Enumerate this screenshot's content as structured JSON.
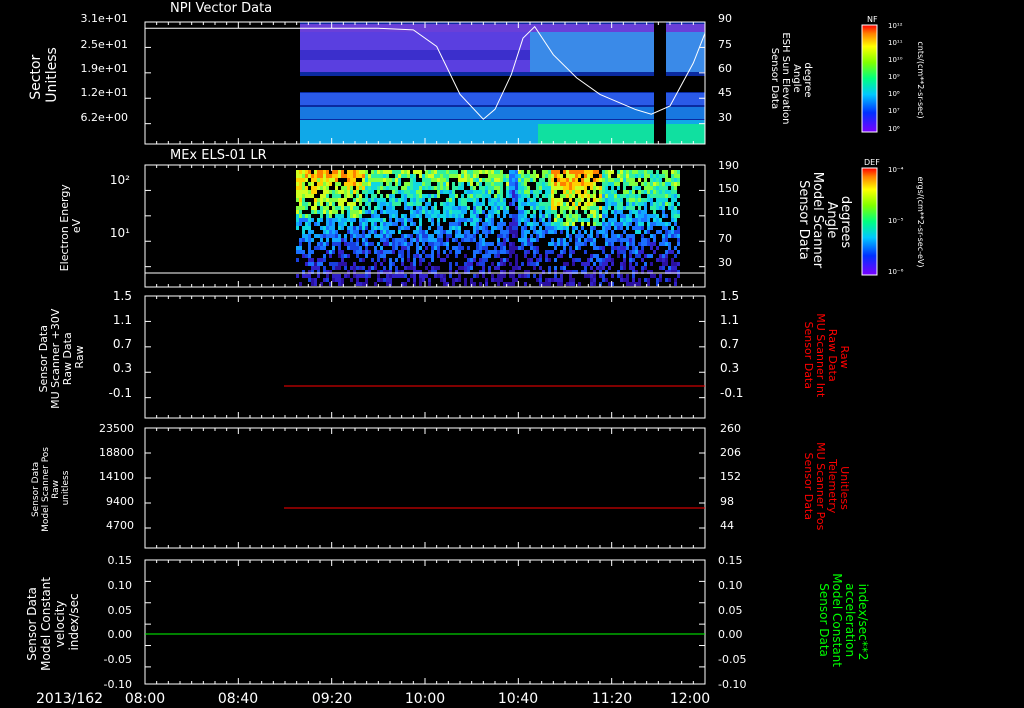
{
  "time_axis": {
    "date": "2013/162",
    "ticks": [
      "08:00",
      "08:40",
      "09:20",
      "10:00",
      "10:40",
      "11:20",
      "12:00"
    ]
  },
  "colors": {
    "white": "#ffffff",
    "red": "#ff0000",
    "green": "#00ff00"
  },
  "panels": [
    {
      "id": "npi",
      "title": "NPI Vector Data",
      "left_label": [
        "Sector",
        "Unitless"
      ],
      "left_ticks": [
        "3.1e+01",
        "2.5e+01",
        "1.9e+01",
        "1.2e+01",
        "6.2e+00"
      ],
      "right_label": [
        "Sensor Data",
        "ESH Sun Elevation",
        "Angle",
        "degree"
      ],
      "right_ticks": [
        "90",
        "75",
        "60",
        "45",
        "30"
      ],
      "right_label_color": "#ffffff"
    },
    {
      "id": "els",
      "title": "MEx ELS-01 LR",
      "left_label": [
        "Electron Energy",
        "eV"
      ],
      "left_ticks": [
        "10²",
        "10¹"
      ],
      "right_label": [
        "Sensor Data",
        "Model Scanner",
        "Angle",
        "degrees"
      ],
      "right_ticks": [
        "190",
        "150",
        "110",
        "70",
        "30"
      ],
      "right_label_color": "#ffffff"
    },
    {
      "id": "mu_raw",
      "title": "",
      "left_label": [
        "Sensor Data",
        "MU Scanner +30V",
        "Raw Data",
        "Raw"
      ],
      "left_ticks": [
        "1.5",
        "1.1",
        "0.7",
        "0.3",
        "-0.1"
      ],
      "right_label": [
        "Sensor Data",
        "MU Scanner Int",
        "Raw Data",
        "Raw"
      ],
      "right_ticks": [
        "1.5",
        "1.1",
        "0.7",
        "0.3",
        "-0.1"
      ],
      "right_label_color": "#ff0000"
    },
    {
      "id": "scanner_pos",
      "title": "",
      "left_label": [
        "Sensor Data",
        "Model Scanner Pos",
        "Raw",
        "unitless"
      ],
      "left_ticks": [
        "23500",
        "18800",
        "14100",
        "9400",
        "4700"
      ],
      "right_label": [
        "Sensor Data",
        "MU Scanner Pos",
        "Telemetry",
        "Unitless"
      ],
      "right_ticks": [
        "260",
        "206",
        "152",
        "98",
        "44"
      ],
      "right_label_color": "#ff0000"
    },
    {
      "id": "velocity",
      "title": "",
      "left_label": [
        "Sensor Data",
        "Model Constant",
        "velocity",
        "index/sec"
      ],
      "left_ticks": [
        "0.15",
        "0.10",
        "0.05",
        "0.00",
        "-0.05",
        "-0.10"
      ],
      "right_label": [
        "Sensor Data",
        "Model Constant",
        "acceleration",
        "index/sec**2"
      ],
      "right_ticks": [
        "0.15",
        "0.10",
        "0.05",
        "0.00",
        "-0.05",
        "-0.10"
      ],
      "right_label_color": "#00ff00"
    }
  ],
  "colorbars": [
    {
      "id": "nf",
      "label": "NF",
      "unit": "cnts/(cm**2-sr-sec)",
      "ticks": [
        "10¹²",
        "10¹¹",
        "10¹⁰",
        "10⁹",
        "10⁸",
        "10⁷",
        "10⁶"
      ]
    },
    {
      "id": "def",
      "label": "DEF",
      "unit": "ergs/(cm**2-sr-sec-eV)",
      "ticks": [
        "10⁻⁴",
        "10⁻⁵",
        "10⁻⁶"
      ]
    }
  ],
  "chart_data": [
    {
      "type": "heatmap",
      "title": "NPI Vector Data",
      "ylabel": "Sector Unitless",
      "overlay_series": {
        "name": "ESH Sun Elevation Angle",
        "axis": "right",
        "ylim": [
          15,
          90
        ],
        "x": [
          "08:00",
          "09:25",
          "09:40",
          "09:55",
          "10:05",
          "10:15",
          "10:25",
          "10:30",
          "10:37",
          "10:42",
          "10:47",
          "10:55",
          "11:05",
          "11:15",
          "11:30",
          "11:37",
          "11:45",
          "11:55",
          "12:00"
        ],
        "values": [
          85,
          85,
          85,
          84,
          74,
          45,
          30,
          36,
          57,
          79,
          86,
          69,
          55,
          45,
          36,
          33,
          38,
          64,
          82
        ]
      }
    },
    {
      "type": "heatmap",
      "title": "MEx ELS-01 LR",
      "ylabel": "Electron Energy eV",
      "overlay_series": {
        "name": "Model Scanner Angle",
        "axis": "right",
        "ylim": [
          0,
          190
        ],
        "x": [
          "08:00",
          "12:00"
        ],
        "values": [
          10,
          10
        ]
      }
    },
    {
      "type": "line",
      "series": [
        {
          "name": "MU Scanner Int Raw",
          "color": "#ff0000",
          "x": [
            "09:00",
            "12:00"
          ],
          "values": [
            0,
            0
          ]
        }
      ],
      "ylim": [
        -0.3,
        1.5
      ]
    },
    {
      "type": "line",
      "series": [
        {
          "name": "MU Scanner Pos Telemetry",
          "color": "#ff0000",
          "x": [
            "09:00",
            "12:00"
          ],
          "values": [
            89,
            89
          ]
        }
      ],
      "ylim": [
        0,
        260
      ]
    },
    {
      "type": "line",
      "series": [
        {
          "name": "Model Constant acceleration",
          "color": "#00ff00",
          "x": [
            "08:00",
            "12:00"
          ],
          "values": [
            0,
            0
          ]
        }
      ],
      "ylim": [
        -0.1,
        0.15
      ]
    }
  ]
}
